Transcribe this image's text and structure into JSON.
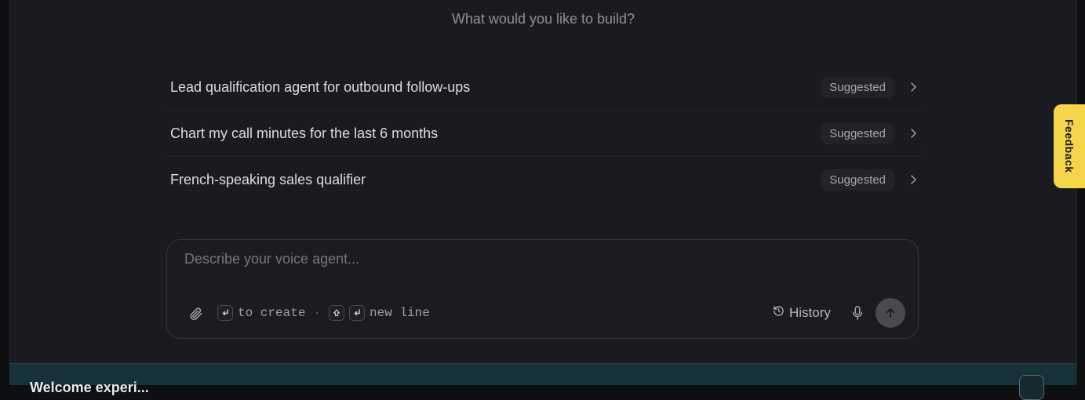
{
  "heading": "What would you like to build?",
  "suggestions": [
    {
      "text": "Lead qualification agent for outbound follow-ups",
      "badge": "Suggested"
    },
    {
      "text": "Chart my call minutes for the last 6 months",
      "badge": "Suggested"
    },
    {
      "text": "French-speaking sales qualifier",
      "badge": "Suggested"
    }
  ],
  "composer": {
    "placeholder": "Describe your voice agent...",
    "hint_create": "to create",
    "hint_separator": "·",
    "hint_newline": "new line",
    "history_label": "History"
  },
  "bottom_banner": {
    "text": "Welcome experi..."
  },
  "feedback_tab": "Feedback",
  "colors": {
    "background": "#1a1b1e",
    "feedback": "#f5d54a",
    "banner": "#173139"
  }
}
